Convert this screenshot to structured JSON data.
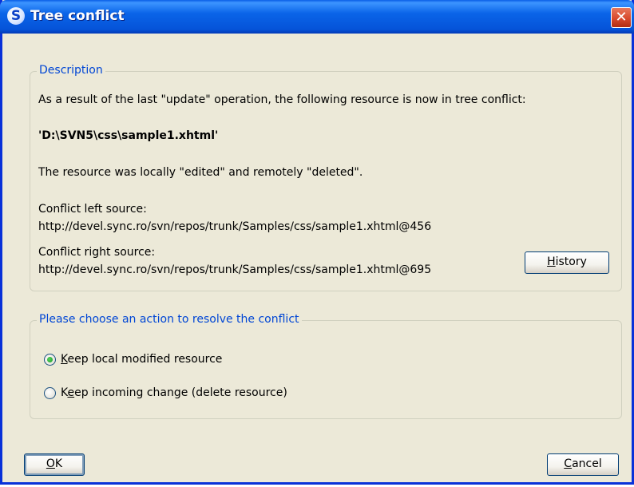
{
  "window": {
    "title": "Tree conflict",
    "app_icon": "S",
    "close_glyph": "✕"
  },
  "description": {
    "legend": "Description",
    "intro": "As a result of the last \"update\" operation, the following resource is now in tree conflict:",
    "resource_path": "'D:\\SVN5\\css\\sample1.xhtml'",
    "status": "The resource was locally \"edited\" and remotely \"deleted\".",
    "left_source_label": "Conflict left source:",
    "left_source_url": "http://devel.sync.ro/svn/repos/trunk/Samples/css/sample1.xhtml@456",
    "right_source_label": "Conflict right source:",
    "right_source_url": "http://devel.sync.ro/svn/repos/trunk/Samples/css/sample1.xhtml@695",
    "history_button": {
      "mnemonic": "H",
      "rest": "istory"
    }
  },
  "action": {
    "legend": "Please choose an action to resolve the conflict",
    "options": [
      {
        "mnemonic": "K",
        "rest": "eep local modified resource",
        "checked": true
      },
      {
        "prefix": "K",
        "mnemonic": "e",
        "rest": "ep incoming change (delete resource)",
        "checked": false
      }
    ]
  },
  "buttons": {
    "ok": {
      "mnemonic": "O",
      "rest": "K"
    },
    "cancel": {
      "mnemonic": "C",
      "rest": "ancel"
    }
  }
}
